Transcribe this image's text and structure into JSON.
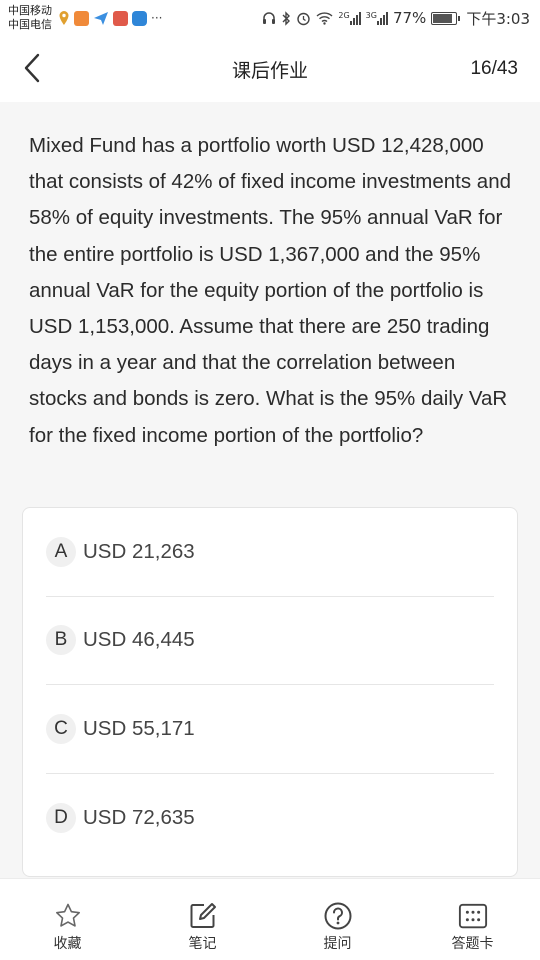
{
  "status_bar": {
    "carrier_1": "中国移动",
    "carrier_2": "中国电信",
    "notification_icons": [
      "location-pin-icon",
      "video-app-icon",
      "plane-app-icon",
      "game-app-icon",
      "chat-app-icon"
    ],
    "more": "···",
    "network_1": "2G",
    "network_2": "3G",
    "battery": "77%",
    "battery_level": 0.77,
    "time": "下午3:03"
  },
  "header": {
    "back_icon": "chevron-left-icon",
    "title": "课后作业",
    "progress": "16/43"
  },
  "question": {
    "text": "Mixed Fund has a portfolio worth USD 12,428,000 that consists of 42% of fixed income investments and 58% of equity investments. The 95% annual VaR for the entire portfolio is USD 1,367,000 and the 95% annual VaR for the equity portion of the portfolio is USD 1,153,000. Assume that there are 250 trading days in a year and that the correlation between stocks and bonds is zero. What is the 95% daily VaR for the fixed income portion of the portfolio?"
  },
  "options": [
    {
      "letter": "A",
      "text": "USD 21,263"
    },
    {
      "letter": "B",
      "text": "USD 46,445"
    },
    {
      "letter": "C",
      "text": "USD 55,171"
    },
    {
      "letter": "D",
      "text": "USD 72,635"
    }
  ],
  "bottom_bar": {
    "tabs": [
      {
        "label": "收藏",
        "icon": "star-icon"
      },
      {
        "label": "笔记",
        "icon": "edit-note-icon"
      },
      {
        "label": "提问",
        "icon": "question-icon"
      },
      {
        "label": "答题卡",
        "icon": "answer-card-icon"
      }
    ]
  },
  "colors": {
    "background": "#f6f6f6",
    "surface": "#ffffff",
    "text": "#2b2b2b",
    "icon": "#555555"
  }
}
